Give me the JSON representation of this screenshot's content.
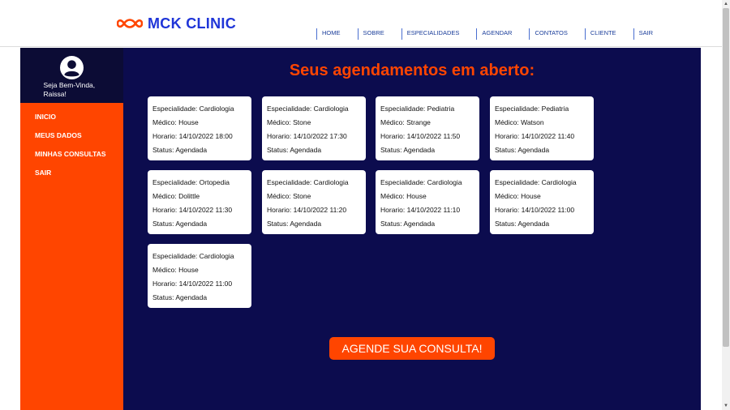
{
  "header": {
    "logo_text": "MCK CLINIC",
    "nav": [
      "HOME",
      "SOBRE",
      "ESPECIALIDADES",
      "AGENDAR",
      "CONTATOS",
      "CLIENTE",
      "SAIR"
    ]
  },
  "sidebar": {
    "welcome": "Seja Bem-Vinda, Raissa!",
    "menu": [
      "INICIO",
      "MEUS DADOS",
      "MINHAS CONSULTAS",
      "SAIR"
    ]
  },
  "main": {
    "title": "Seus agendamentos em aberto:",
    "cta_label": "AGENDE SUA CONSULTA!"
  },
  "appointments": [
    {
      "especialidade": "Especialidade: Cardiologia",
      "medico": "Médico: House",
      "horario": "Horario: 14/10/2022 18:00",
      "status": "Status: Agendada"
    },
    {
      "especialidade": "Especialidade: Cardiologia",
      "medico": "Médico: Stone",
      "horario": "Horario: 14/10/2022 17:30",
      "status": "Status: Agendada"
    },
    {
      "especialidade": "Especialidade: Pediatria",
      "medico": "Médico: Strange",
      "horario": "Horario: 14/10/2022 11:50",
      "status": "Status: Agendada"
    },
    {
      "especialidade": "Especialidade: Pediatria",
      "medico": "Médico: Watson",
      "horario": "Horario: 14/10/2022 11:40",
      "status": "Status: Agendada"
    },
    {
      "especialidade": "Especialidade: Ortopedia",
      "medico": "Médico: Dolittle",
      "horario": "Horario: 14/10/2022 11:30",
      "status": "Status: Agendada"
    },
    {
      "especialidade": "Especialidade: Cardiologia",
      "medico": "Médico: Stone",
      "horario": "Horario: 14/10/2022 11:20",
      "status": "Status: Agendada"
    },
    {
      "especialidade": "Especialidade: Cardiologia",
      "medico": "Médico: House",
      "horario": "Horario: 14/10/2022 11:10",
      "status": "Status: Agendada"
    },
    {
      "especialidade": "Especialidade: Cardiologia",
      "medico": "Médico: House",
      "horario": "Horario: 14/10/2022 11:00",
      "status": "Status: Agendada"
    },
    {
      "especialidade": "Especialidade: Cardiologia",
      "medico": "Médico: House",
      "horario": "Horario: 14/10/2022 11:00",
      "status": "Status: Agendada"
    }
  ],
  "colors": {
    "accent": "#ff4500",
    "navy": "#0c0c4e",
    "brand_blue": "#1f35d8"
  },
  "icons": {
    "logo": "infinity-icon",
    "avatar": "user-avatar-icon"
  }
}
